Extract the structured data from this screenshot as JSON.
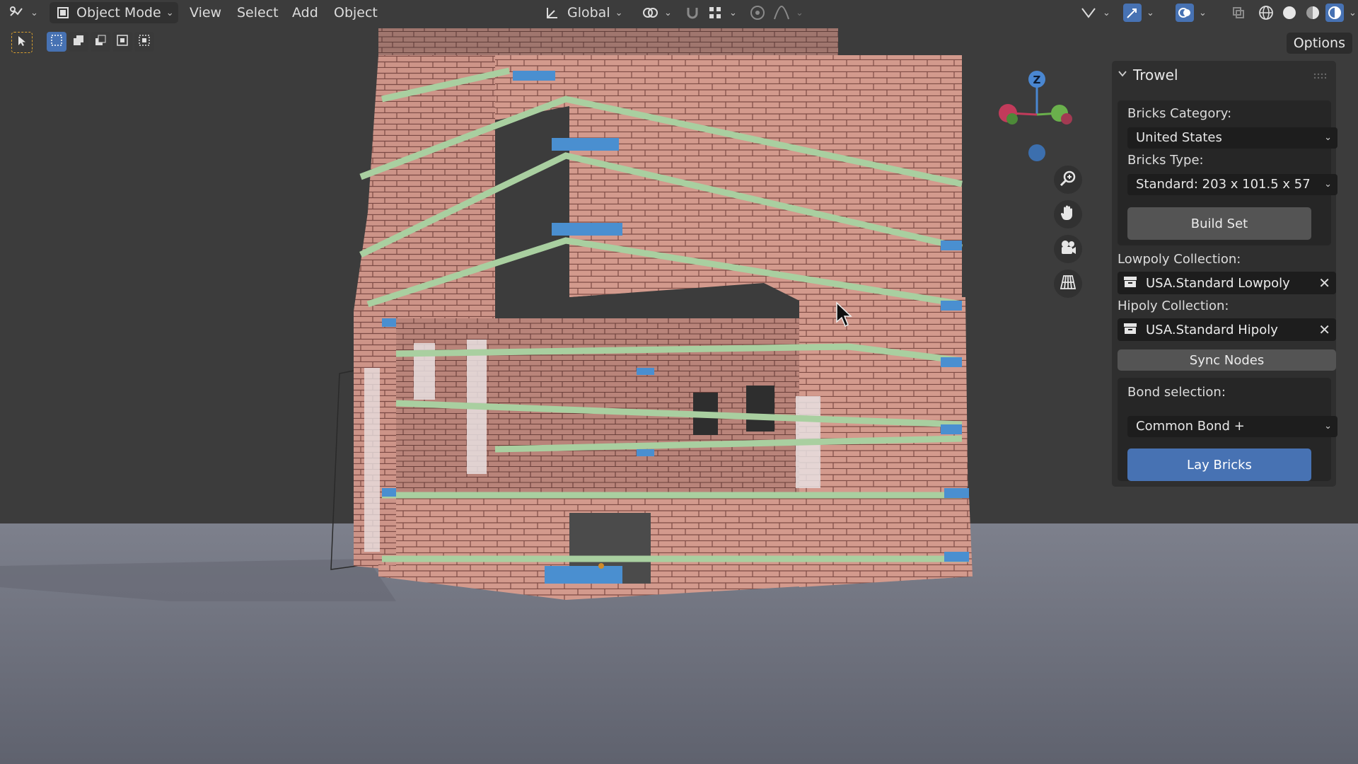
{
  "header": {
    "mode_label": "Object Mode",
    "menu": [
      "View",
      "Select",
      "Add",
      "Object"
    ],
    "orientation_label": "Global",
    "options_label": "Options"
  },
  "gizmo": {
    "z_label": "Z"
  },
  "trowel": {
    "title": "Trowel",
    "bricks_category_label": "Bricks Category:",
    "bricks_category_value": "United States",
    "bricks_type_label": "Bricks Type:",
    "bricks_type_value": "Standard: 203 x 101.5 x 57",
    "build_set_label": "Build Set",
    "lowpoly_label": "Lowpoly Collection:",
    "lowpoly_value": "USA.Standard Lowpoly",
    "hipoly_label": "Hipoly Collection:",
    "hipoly_value": "USA.Standard Hipoly",
    "sync_nodes_label": "Sync Nodes",
    "bond_label": "Bond selection:",
    "bond_value": "Common Bond +",
    "lay_bricks_label": "Lay Bricks"
  },
  "colors": {
    "accent": "#4772b3",
    "brick": "#c98f84",
    "brick_blue": "#4a8fd0",
    "brick_green": "#a9cfa0",
    "floor": "#7a7c88"
  },
  "icons": [
    "editor-type-icon",
    "object-mode-icon",
    "transform-orientation-icon",
    "pivot-icon",
    "snap-icon",
    "proportional-icon",
    "falloff-icon",
    "visibility-icon",
    "gizmo-icon",
    "overlay-icon",
    "xray-icon",
    "wireframe-shading-icon",
    "solid-shading-icon",
    "material-shading-icon",
    "rendered-shading-icon",
    "select-tool-icon",
    "zoom-icon",
    "hand-icon",
    "camera-icon",
    "grid-icon",
    "collection-icon",
    "close-icon",
    "chevron-down-icon"
  ]
}
